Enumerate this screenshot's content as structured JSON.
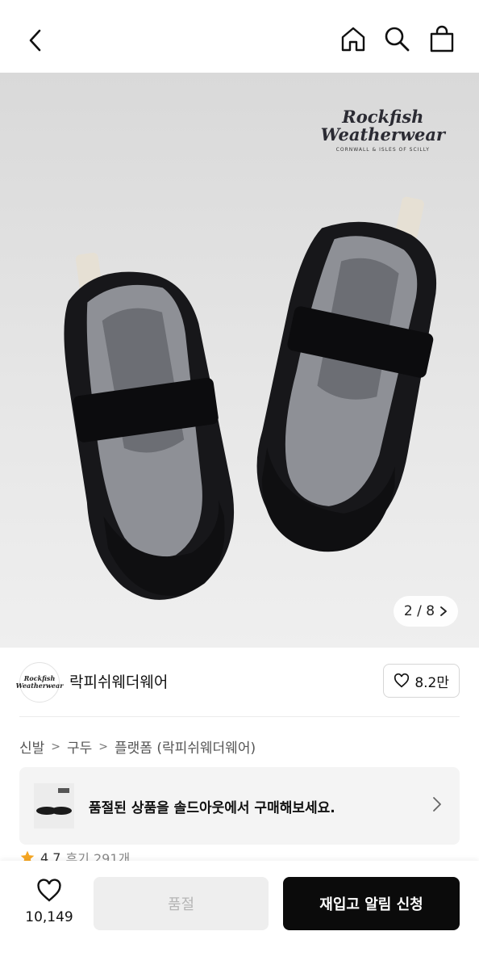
{
  "header": {
    "back_icon": "chevron-left-icon",
    "home_icon": "home-icon",
    "search_icon": "search-icon",
    "cart_icon": "shopping-bag-icon"
  },
  "hero": {
    "brand_mark_line1": "Rockfish",
    "brand_mark_line2": "Weatherwear",
    "brand_mark_sub": "CORNWALL & ISLES OF SCILLY",
    "counter_text": "2 / 8"
  },
  "brand": {
    "avatar_line1": "Rockfish",
    "avatar_line2": "Weatherwear",
    "name": "락피쉬웨더웨어",
    "likes": "8.2만"
  },
  "breadcrumb": [
    "신발",
    "구두",
    "플랫폼 (락피쉬웨더웨어)"
  ],
  "soldout_banner": {
    "text": "품절된 상품을 솔드아웃에서 구매해보세요."
  },
  "rating": {
    "score": "4.7",
    "reviews": "후기 291개"
  },
  "bottom": {
    "wish_count": "10,149",
    "soldout_label": "품절",
    "restock_label": "재입고 알림 신청"
  },
  "colors": {
    "primary_button": "#0b0b0b",
    "disabled_button": "#eeeeee",
    "star": "#f5a623"
  }
}
